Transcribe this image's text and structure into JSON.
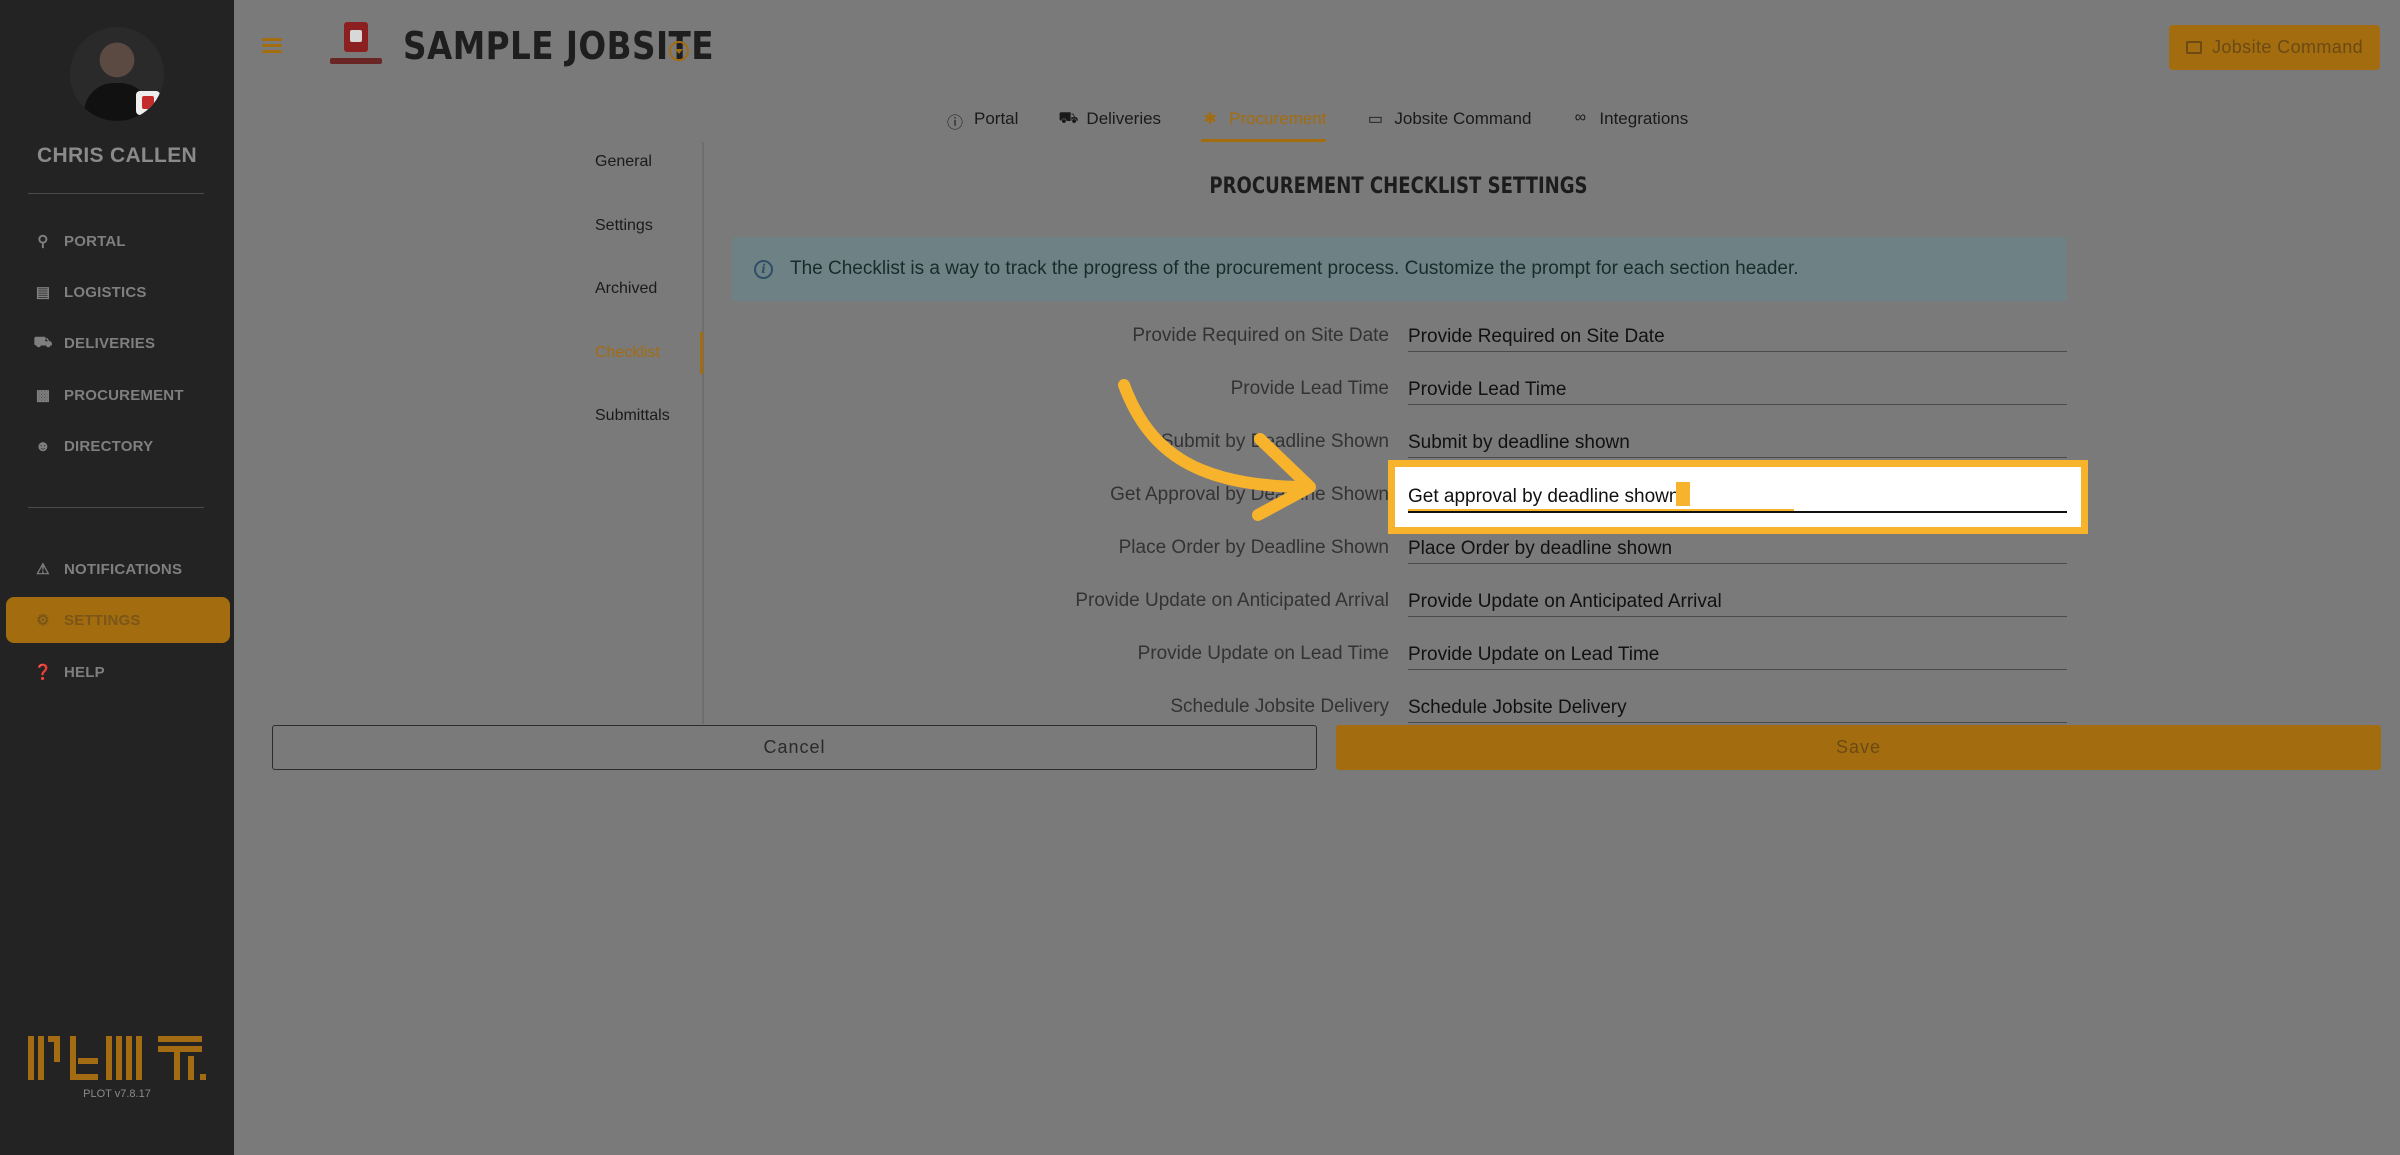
{
  "sidebar": {
    "user_name": "CHRIS CALLEN",
    "items": [
      {
        "label": "PORTAL",
        "icon": "sitemap-icon"
      },
      {
        "label": "LOGISTICS",
        "icon": "map-icon"
      },
      {
        "label": "DELIVERIES",
        "icon": "truck-icon"
      },
      {
        "label": "PROCUREMENT",
        "icon": "cubes-icon"
      },
      {
        "label": "DIRECTORY",
        "icon": "users-icon"
      }
    ],
    "secondary_items": [
      {
        "label": "NOTIFICATIONS",
        "icon": "bell-icon"
      },
      {
        "label": "SETTINGS",
        "icon": "gear-icon",
        "active": true
      },
      {
        "label": "HELP",
        "icon": "question-circle-icon"
      }
    ],
    "version": "PLOT v7.8.17"
  },
  "header": {
    "title": "SAMPLE JOBSITE",
    "jobsite_command_label": "Jobsite Command"
  },
  "tabs": [
    {
      "label": "Portal",
      "icon": "info-circle-icon"
    },
    {
      "label": "Deliveries",
      "icon": "truck-icon"
    },
    {
      "label": "Procurement",
      "icon": "puzzle-icon",
      "active": true
    },
    {
      "label": "Jobsite Command",
      "icon": "monitor-icon"
    },
    {
      "label": "Integrations",
      "icon": "link-icon"
    }
  ],
  "sub_nav": [
    {
      "label": "General"
    },
    {
      "label": "Settings"
    },
    {
      "label": "Archived"
    },
    {
      "label": "Checklist",
      "active": true
    },
    {
      "label": "Submittals"
    }
  ],
  "content": {
    "section_title": "PROCUREMENT CHECKLIST SETTINGS",
    "info_text": "The Checklist is a way to track the progress of the procurement process. Customize the prompt for each section header.",
    "rows": [
      {
        "label": "Provide Required on Site Date",
        "value": "Provide Required on Site Date"
      },
      {
        "label": "Provide Lead Time",
        "value": "Provide Lead Time"
      },
      {
        "label": "Submit by Deadline Shown",
        "value": "Submit by deadline shown"
      },
      {
        "label": "Get Approval by Deadline Shown",
        "value": "Get approval by deadline shown",
        "focused": true
      },
      {
        "label": "Place Order by Deadline Shown",
        "value": "Place Order by deadline shown"
      },
      {
        "label": "Provide Update on Anticipated Arrival",
        "value": "Provide Update on Anticipated Arrival"
      },
      {
        "label": "Provide Update on Lead Time",
        "value": "Provide Update on Lead Time"
      },
      {
        "label": "Schedule Jobsite Delivery",
        "value": "Schedule Jobsite Delivery"
      }
    ]
  },
  "footer": {
    "cancel_label": "Cancel",
    "save_label": "Save"
  },
  "colors": {
    "accent": "#a36c0f",
    "highlight": "#f7b32b",
    "sidebar_bg": "#232323",
    "overlay_bg": "#7a7a7a"
  }
}
